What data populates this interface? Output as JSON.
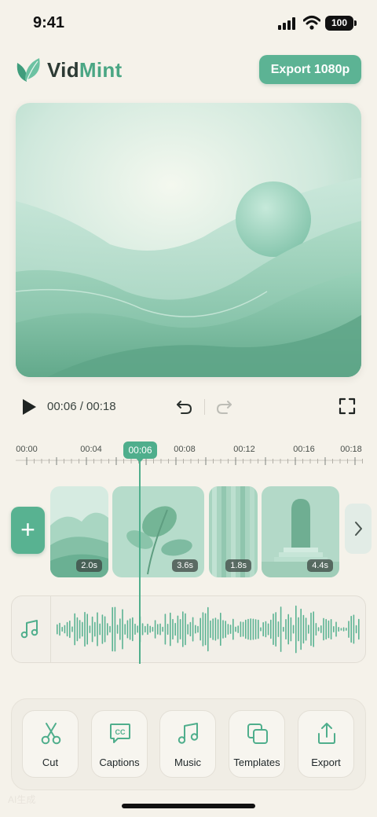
{
  "status": {
    "time": "9:41",
    "battery": "100"
  },
  "header": {
    "brand_main": "Vid",
    "brand_accent": "Mint",
    "export_label": "Export 1080p"
  },
  "player": {
    "timecode": "00:06 / 00:18"
  },
  "timeline": {
    "ticks": [
      "00:00",
      "00:04",
      "00:06",
      "00:08",
      "00:12",
      "00:16",
      "00:18"
    ],
    "playhead": "00:06"
  },
  "clips": [
    {
      "name": "hills",
      "duration": "2.0s"
    },
    {
      "name": "leaf",
      "duration": "3.6s"
    },
    {
      "name": "curtain",
      "duration": "1.8s"
    },
    {
      "name": "arch",
      "duration": "4.4s"
    }
  ],
  "toolbar": {
    "cut": "Cut",
    "captions": "Captions",
    "captions_icon_text": "CC",
    "music": "Music",
    "templates": "Templates",
    "export": "Export"
  },
  "watermark": "AI生成",
  "colors": {
    "accent": "#5cb394",
    "background": "#f5f2ea"
  }
}
